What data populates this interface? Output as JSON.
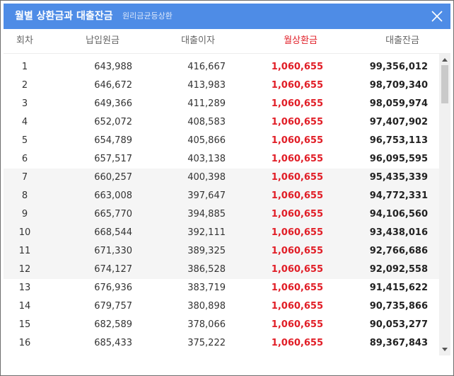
{
  "window": {
    "title": "월별 상환금과 대출잔금",
    "subtitle": "원리금균등상환",
    "close_icon": "close-icon",
    "accent_color": "#4e8ce6",
    "highlight_color": "#e11d26"
  },
  "table": {
    "headers": [
      "회차",
      "납입원금",
      "대출이자",
      "월상환금",
      "대출잔금"
    ],
    "rows": [
      {
        "no": "1",
        "principal": "643,988",
        "interest": "416,667",
        "payment": "1,060,655",
        "balance": "99,356,012"
      },
      {
        "no": "2",
        "principal": "646,672",
        "interest": "413,983",
        "payment": "1,060,655",
        "balance": "98,709,340"
      },
      {
        "no": "3",
        "principal": "649,366",
        "interest": "411,289",
        "payment": "1,060,655",
        "balance": "98,059,974"
      },
      {
        "no": "4",
        "principal": "652,072",
        "interest": "408,583",
        "payment": "1,060,655",
        "balance": "97,407,902"
      },
      {
        "no": "5",
        "principal": "654,789",
        "interest": "405,866",
        "payment": "1,060,655",
        "balance": "96,753,113"
      },
      {
        "no": "6",
        "principal": "657,517",
        "interest": "403,138",
        "payment": "1,060,655",
        "balance": "96,095,595"
      },
      {
        "no": "7",
        "principal": "660,257",
        "interest": "400,398",
        "payment": "1,060,655",
        "balance": "95,435,339"
      },
      {
        "no": "8",
        "principal": "663,008",
        "interest": "397,647",
        "payment": "1,060,655",
        "balance": "94,772,331"
      },
      {
        "no": "9",
        "principal": "665,770",
        "interest": "394,885",
        "payment": "1,060,655",
        "balance": "94,106,560"
      },
      {
        "no": "10",
        "principal": "668,544",
        "interest": "392,111",
        "payment": "1,060,655",
        "balance": "93,438,016"
      },
      {
        "no": "11",
        "principal": "671,330",
        "interest": "389,325",
        "payment": "1,060,655",
        "balance": "92,766,686"
      },
      {
        "no": "12",
        "principal": "674,127",
        "interest": "386,528",
        "payment": "1,060,655",
        "balance": "92,092,558"
      },
      {
        "no": "13",
        "principal": "676,936",
        "interest": "383,719",
        "payment": "1,060,655",
        "balance": "91,415,622"
      },
      {
        "no": "14",
        "principal": "679,757",
        "interest": "380,898",
        "payment": "1,060,655",
        "balance": "90,735,866"
      },
      {
        "no": "15",
        "principal": "682,589",
        "interest": "378,066",
        "payment": "1,060,655",
        "balance": "90,053,277"
      },
      {
        "no": "16",
        "principal": "685,433",
        "interest": "375,222",
        "payment": "1,060,655",
        "balance": "89,367,843"
      }
    ]
  }
}
